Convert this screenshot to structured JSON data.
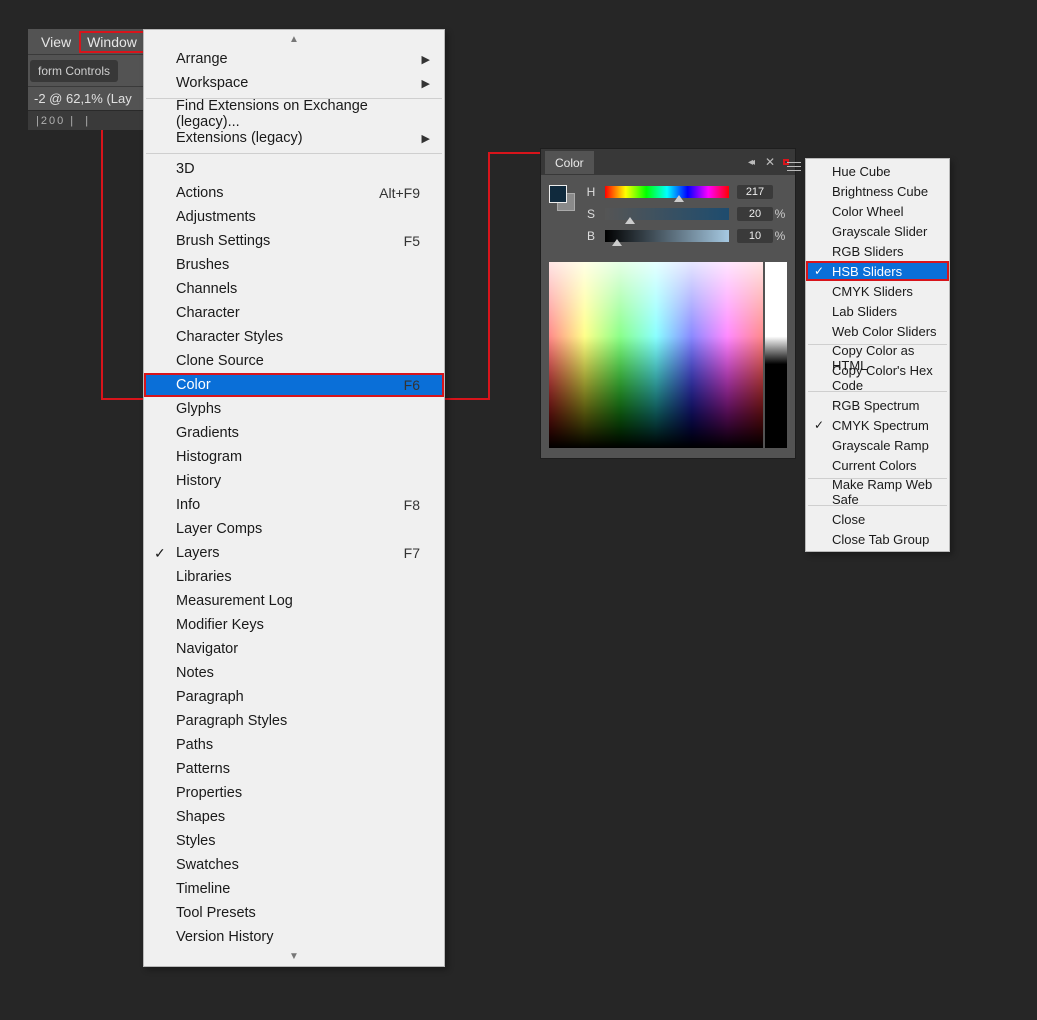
{
  "menubar": {
    "view": "View",
    "window": "Window"
  },
  "toolbar_chip": "form Controls",
  "document_tab": "-2 @ 62,1% (Lay",
  "ruler_mark": "200",
  "window_menu": {
    "arrange": "Arrange",
    "workspace": "Workspace",
    "find_ext": "Find Extensions on Exchange (legacy)...",
    "ext_legacy": "Extensions (legacy)",
    "items": [
      {
        "label": "3D"
      },
      {
        "label": "Actions",
        "shortcut": "Alt+F9"
      },
      {
        "label": "Adjustments"
      },
      {
        "label": "Brush Settings",
        "shortcut": "F5"
      },
      {
        "label": "Brushes"
      },
      {
        "label": "Channels"
      },
      {
        "label": "Character"
      },
      {
        "label": "Character Styles"
      },
      {
        "label": "Clone Source"
      },
      {
        "label": "Color",
        "shortcut": "F6",
        "selected": true
      },
      {
        "label": "Glyphs"
      },
      {
        "label": "Gradients"
      },
      {
        "label": "Histogram"
      },
      {
        "label": "History"
      },
      {
        "label": "Info",
        "shortcut": "F8"
      },
      {
        "label": "Layer Comps"
      },
      {
        "label": "Layers",
        "shortcut": "F7",
        "checked": true
      },
      {
        "label": "Libraries"
      },
      {
        "label": "Measurement Log"
      },
      {
        "label": "Modifier Keys"
      },
      {
        "label": "Navigator"
      },
      {
        "label": "Notes"
      },
      {
        "label": "Paragraph"
      },
      {
        "label": "Paragraph Styles"
      },
      {
        "label": "Paths"
      },
      {
        "label": "Patterns"
      },
      {
        "label": "Properties"
      },
      {
        "label": "Shapes"
      },
      {
        "label": "Styles"
      },
      {
        "label": "Swatches"
      },
      {
        "label": "Timeline"
      },
      {
        "label": "Tool Presets"
      },
      {
        "label": "Version History"
      }
    ]
  },
  "color_panel": {
    "title": "Color",
    "sliders": {
      "h": {
        "label": "H",
        "value": "217",
        "thumb": 60
      },
      "s": {
        "label": "S",
        "value": "20",
        "unit": "%",
        "thumb": 20
      },
      "b": {
        "label": "B",
        "value": "10",
        "unit": "%",
        "thumb": 10
      }
    }
  },
  "flyout": {
    "g1": [
      "Hue Cube",
      "Brightness Cube",
      "Color Wheel",
      "Grayscale Slider",
      "RGB Sliders"
    ],
    "hsb": "HSB Sliders",
    "g2": [
      "CMYK Sliders",
      "Lab Sliders",
      "Web Color Sliders"
    ],
    "g3": [
      "Copy Color as HTML",
      "Copy Color's Hex Code"
    ],
    "g4_rgb": "RGB Spectrum",
    "g4_cmyk": "CMYK Spectrum",
    "g4_rest": [
      "Grayscale Ramp",
      "Current Colors"
    ],
    "g5": "Make Ramp Web Safe",
    "g6": [
      "Close",
      "Close Tab Group"
    ]
  }
}
